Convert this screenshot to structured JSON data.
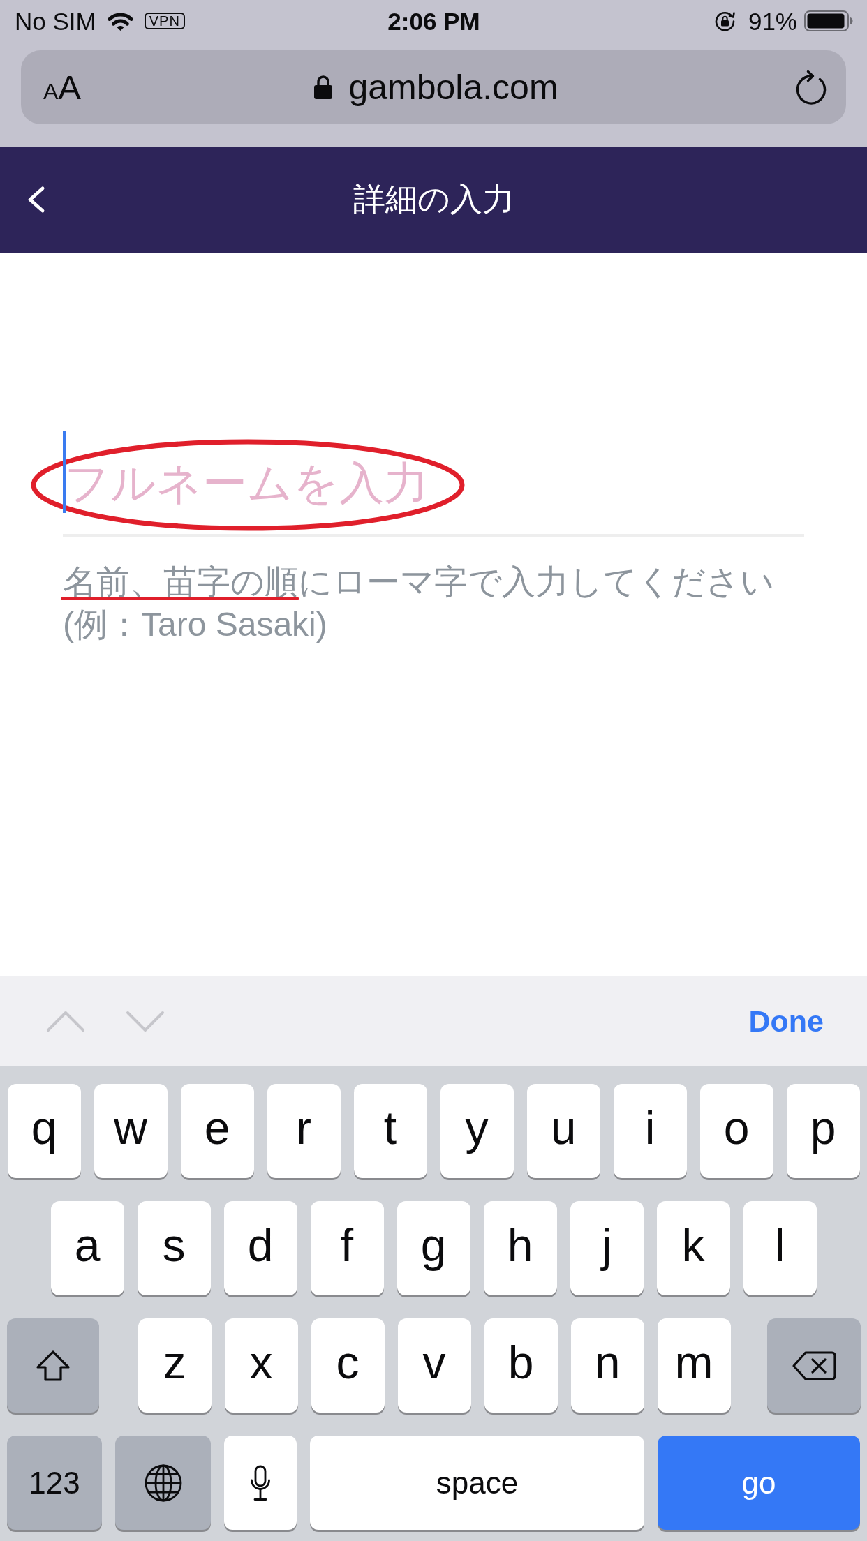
{
  "status_bar": {
    "carrier": "No SIM",
    "vpn_badge": "VPN",
    "time": "2:06 PM",
    "battery_percent": "91%"
  },
  "browser_bar": {
    "text_size_button": "AA",
    "secure": true,
    "url": "gambola.com"
  },
  "nav_bar": {
    "title": "詳細の入力"
  },
  "form": {
    "field": {
      "placeholder": "フルネームを入力",
      "focused": true,
      "circled": true
    },
    "hint": [
      {
        "text": "名前、苗字の順",
        "underlined": true
      },
      {
        "text": "にローマ字で入力してください(例：Taro Sasaki)",
        "underlined": false
      }
    ]
  },
  "keyboard_toolbar": {
    "previous_field": {
      "disabled": true
    },
    "next_field": {
      "disabled": true
    },
    "done": "Done"
  },
  "keyboard": {
    "rows": [
      [
        {
          "kind": "letter",
          "label": "q"
        },
        {
          "kind": "letter",
          "label": "w"
        },
        {
          "kind": "letter",
          "label": "e"
        },
        {
          "kind": "letter",
          "label": "r"
        },
        {
          "kind": "letter",
          "label": "t"
        },
        {
          "kind": "letter",
          "label": "y"
        },
        {
          "kind": "letter",
          "label": "u"
        },
        {
          "kind": "letter",
          "label": "i"
        },
        {
          "kind": "letter",
          "label": "o"
        },
        {
          "kind": "letter",
          "label": "p"
        }
      ],
      [
        {
          "kind": "letter",
          "label": "a"
        },
        {
          "kind": "letter",
          "label": "s"
        },
        {
          "kind": "letter",
          "label": "d"
        },
        {
          "kind": "letter",
          "label": "f"
        },
        {
          "kind": "letter",
          "label": "g"
        },
        {
          "kind": "letter",
          "label": "h"
        },
        {
          "kind": "letter",
          "label": "j"
        },
        {
          "kind": "letter",
          "label": "k"
        },
        {
          "kind": "letter",
          "label": "l"
        }
      ],
      [
        {
          "kind": "shift"
        },
        {
          "kind": "letter",
          "label": "z"
        },
        {
          "kind": "letter",
          "label": "x"
        },
        {
          "kind": "letter",
          "label": "c"
        },
        {
          "kind": "letter",
          "label": "v"
        },
        {
          "kind": "letter",
          "label": "b"
        },
        {
          "kind": "letter",
          "label": "n"
        },
        {
          "kind": "letter",
          "label": "m"
        },
        {
          "kind": "delete"
        }
      ],
      [
        {
          "kind": "numbers",
          "label": "123"
        },
        {
          "kind": "globe"
        },
        {
          "kind": "mic"
        },
        {
          "kind": "space",
          "label": "space"
        },
        {
          "kind": "go",
          "label": "go"
        }
      ]
    ]
  }
}
